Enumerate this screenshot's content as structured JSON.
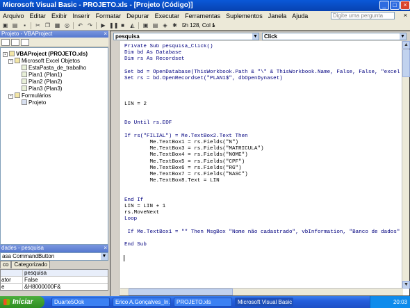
{
  "window": {
    "title": "Microsoft Visual Basic - PROJETO.xls - [Projeto (Código)]"
  },
  "menu": [
    "Arquivo",
    "Editar",
    "Exibir",
    "Inserir",
    "Formatar",
    "Depurar",
    "Executar",
    "Ferramentas",
    "Suplementos",
    "Janela",
    "Ajuda"
  ],
  "ask_placeholder": "Digite uma pergunta",
  "toolbar": {
    "position": "Ln 128, Col 1"
  },
  "project": {
    "title": "Projeto - VBAProject",
    "root": "VBAProject (PROJETO.xls)",
    "folder_excel": "Microsoft Excel Objetos",
    "items": [
      "EstaPasta_de_trabalho",
      "Plan1 (Plan1)",
      "Plan2 (Plan2)",
      "Plan3 (Plan3)"
    ],
    "folder_forms": "Formulários",
    "form": "Projeto"
  },
  "properties": {
    "title": "dades - pesquisa",
    "object": "asa CommandButton",
    "tabs": [
      "co",
      "Categorizado"
    ],
    "rows": [
      {
        "name": "",
        "value": "pesquisa"
      },
      {
        "name": "ator",
        "value": "False"
      },
      {
        "name": "e",
        "value": "&H8000000F&"
      }
    ]
  },
  "code": {
    "object": "pesquisa",
    "procedure": "Click",
    "lines": [
      "Private Sub pesquisa_Click()",
      "Dim bd As Database",
      "Dim rs As Recordset",
      "",
      "Set bd = OpenDatabase(ThisWorkbook.Path & \"\\\" & ThisWorkbook.Name, False, False, \"excel",
      "Set rs = bd.OpenRecordset(\"PLAN1$\", dbOpenDynaset)",
      "",
      "",
      "",
      "LIN = 2",
      "",
      "",
      "Do Until rs.EOF",
      "",
      "If rs(\"FILIAL\") = Me.TextBox2.Text Then",
      "        Me.TextBox1 = rs.Fields(\"N\")",
      "        Me.TextBox3 = rs.Fields(\"MATRICULA\")",
      "        Me.TextBox4 = rs.Fields(\"NOME\")",
      "        Me.TextBox5 = rs.Fields(\"CPF\")",
      "        Me.TextBox6 = rs.Fields(\"RG\")",
      "        Me.TextBox7 = rs.Fields(\"NASC\")",
      "        Me.TextBox8.Text = LIN",
      "",
      "",
      "End If",
      "LIN = LIN + 1",
      "rs.MoveNext",
      "Loop",
      "",
      " If Me.TextBox1 = \"\" Then MsgBox \"Nome não cadastrado\", vbInformation, \"Banco de dados\"",
      "",
      "End Sub"
    ]
  },
  "taskbar": {
    "start": "Iniciar",
    "tasks": [
      "Duarte5Ook",
      "Erico A.Gonçalves_In...",
      "PROJETO.xls",
      "Microsoft Visual Basic ..."
    ],
    "clock": "20:03"
  }
}
